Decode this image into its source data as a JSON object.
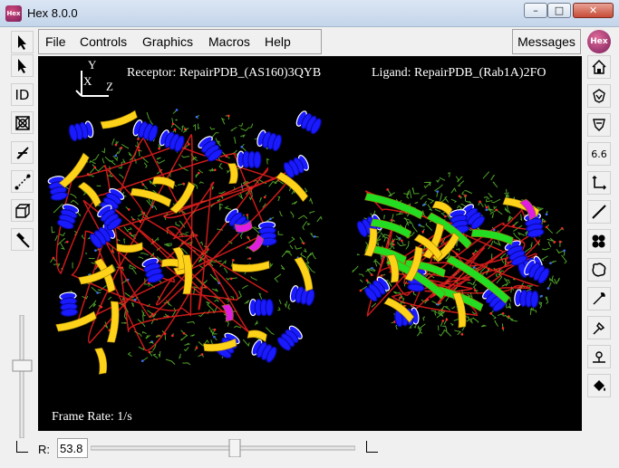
{
  "window": {
    "title": "Hex 8.0.0",
    "app_icon_text": "Hex",
    "controls": [
      "minimize",
      "maximize",
      "close"
    ]
  },
  "menu": {
    "items": [
      "File",
      "Controls",
      "Graphics",
      "Macros",
      "Help"
    ],
    "messages_label": "Messages"
  },
  "left_toolbar": {
    "tools": [
      "select-arrow-icon",
      "pick-arrow-icon",
      "id-icon",
      "clear-icon",
      "bolt-icon",
      "measure-icon",
      "box-icon",
      "hammer-icon"
    ],
    "tool_texts": {
      "id": "ID"
    }
  },
  "right_toolbar": {
    "tools": [
      "home-icon",
      "shield-down-icon",
      "shield-icon",
      "distance-value-icon",
      "axis-icon",
      "line-icon",
      "atoms-icon",
      "surface-icon",
      "wrench-icon",
      "pin-icon",
      "tag-icon",
      "bucket-icon"
    ],
    "distance_text": "6.6"
  },
  "viewport": {
    "background": "#000000",
    "axis_labels": {
      "x": "X",
      "y": "Y",
      "z": "Z"
    },
    "receptor_text": "Receptor: RepairPDB_(AS160)3QYB",
    "ligand_text": "Ligand: RepairPDB_(Rab1A)2FO",
    "frame_rate_text": "Frame Rate: 1/s",
    "colors": {
      "helix": "#1a1aff",
      "strand": "#ffd21a",
      "strand_green": "#22dd22",
      "coil": "#ff2020",
      "turn": "#e01ee0",
      "sidechain": "#4fa32a"
    }
  },
  "bottom": {
    "r_label": "R:",
    "r_value": "53.8"
  }
}
